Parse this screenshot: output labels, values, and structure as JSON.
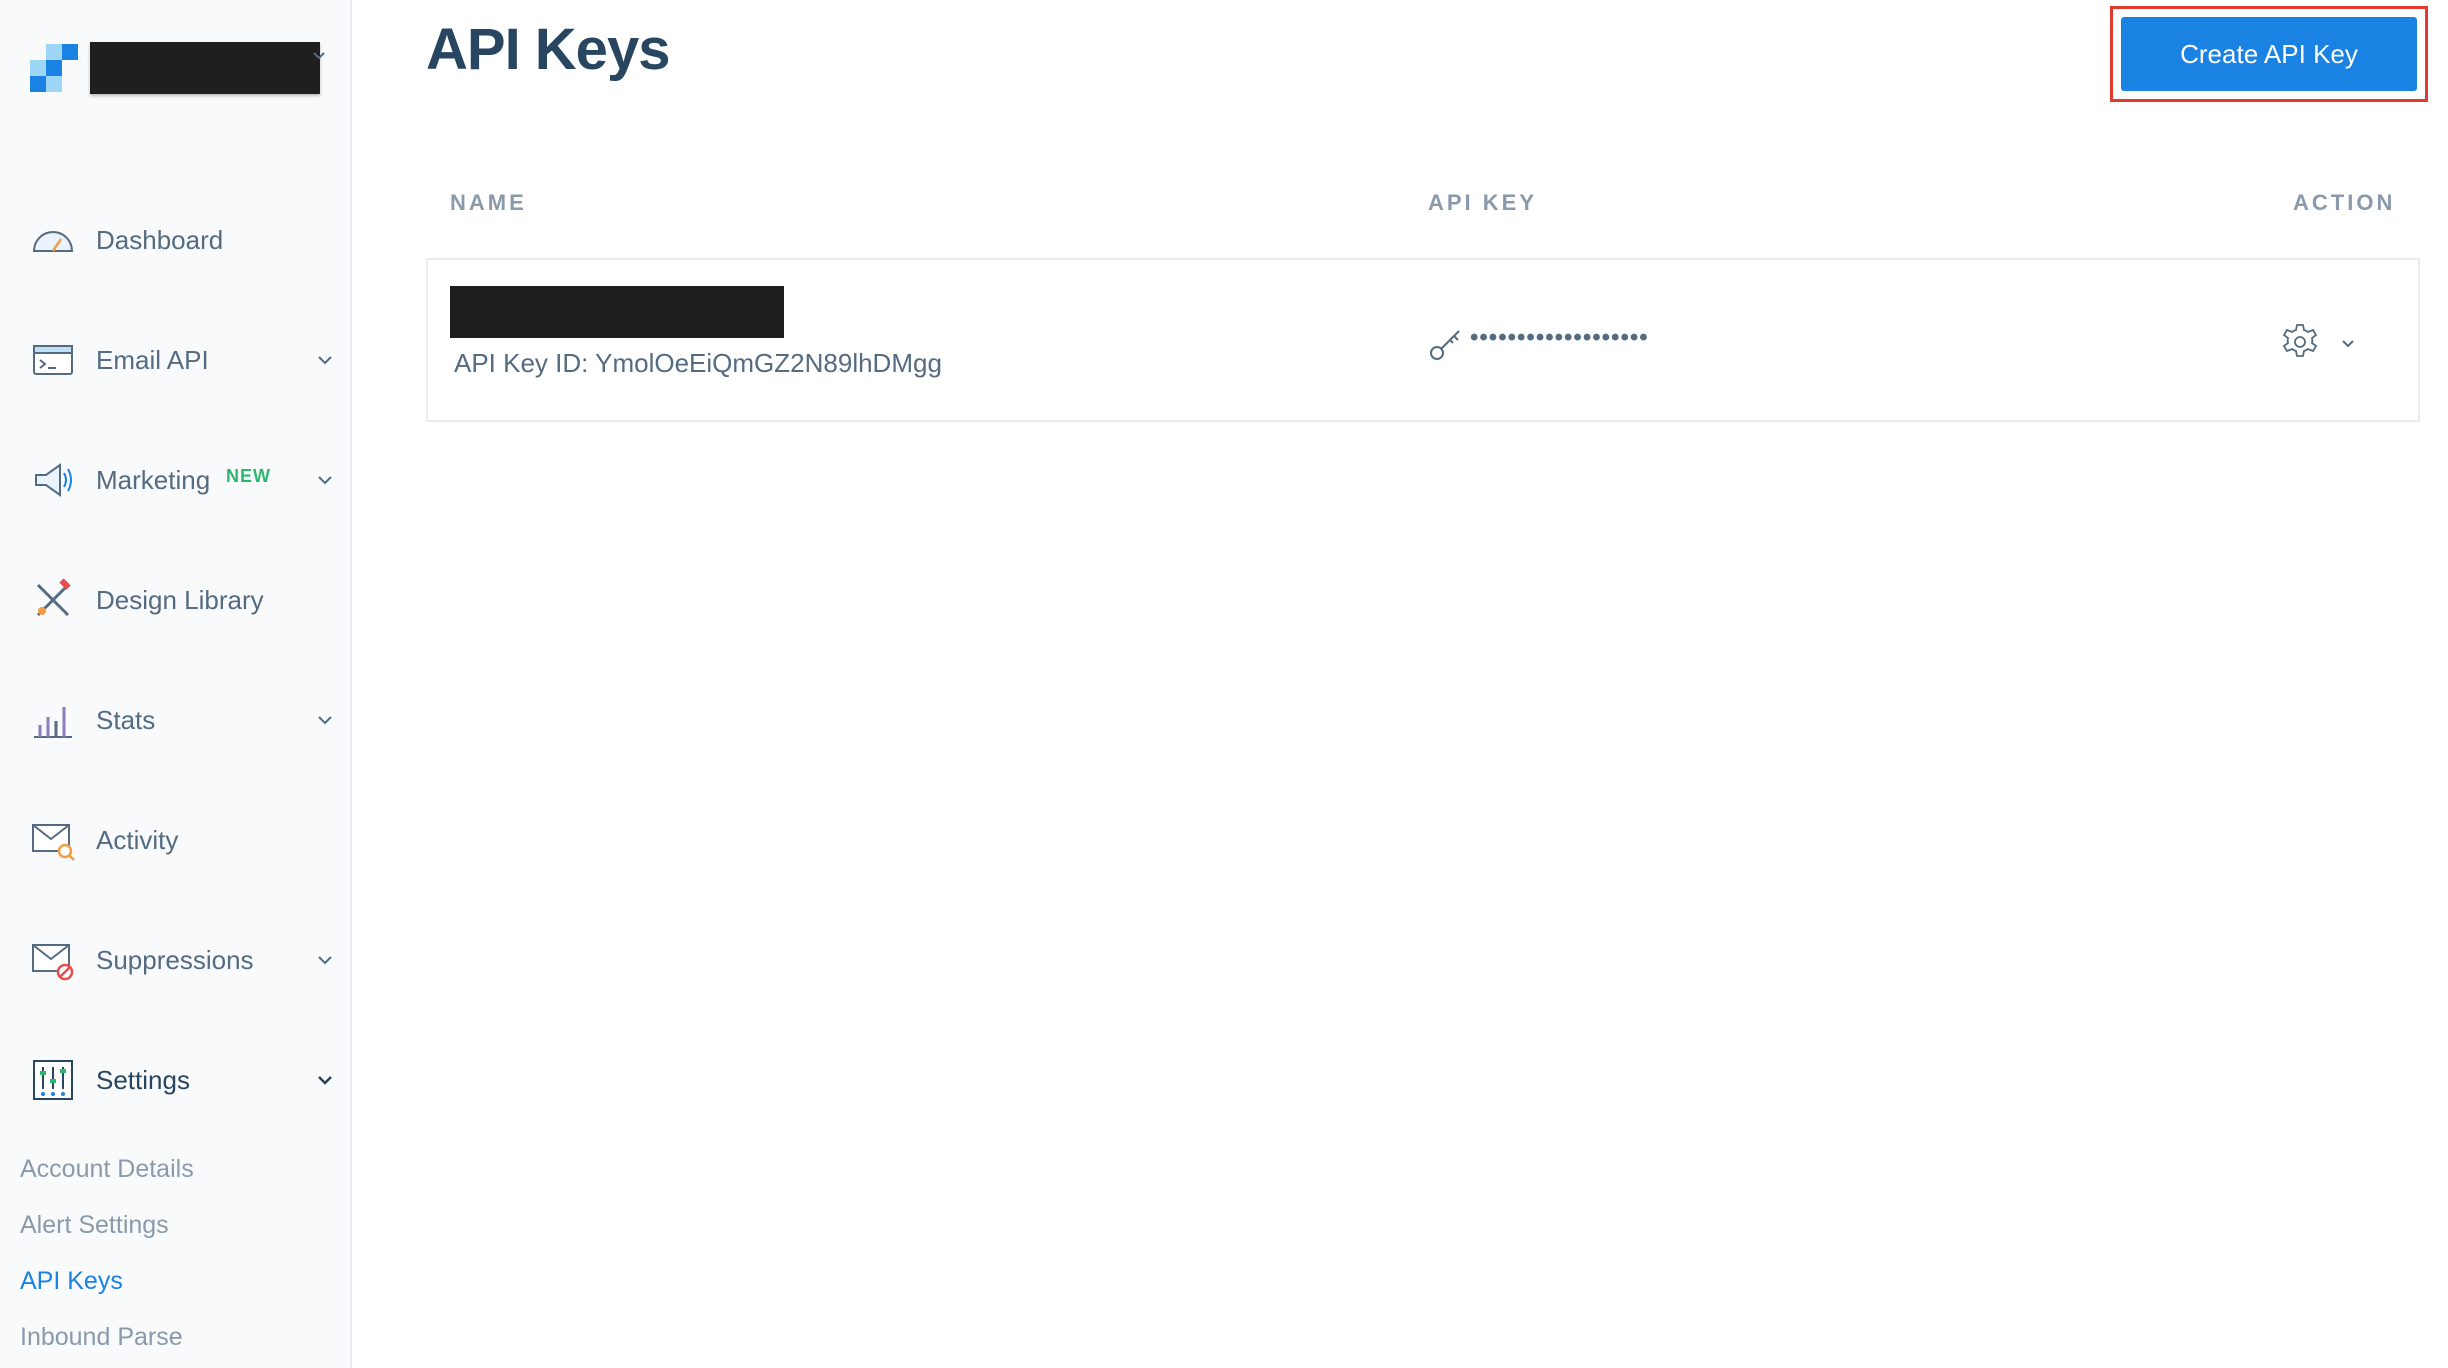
{
  "sidebar": {
    "items": [
      {
        "label": "Dashboard",
        "icon": "gauge-icon"
      },
      {
        "label": "Email API",
        "icon": "terminal-window-icon"
      },
      {
        "label": "Marketing",
        "badge": "NEW",
        "icon": "megaphone-icon"
      },
      {
        "label": "Design Library",
        "icon": "design-tools-icon"
      },
      {
        "label": "Stats",
        "icon": "bar-chart-icon"
      },
      {
        "label": "Activity",
        "icon": "envelope-search-icon"
      },
      {
        "label": "Suppressions",
        "icon": "envelope-block-icon"
      },
      {
        "label": "Settings",
        "icon": "sliders-icon"
      }
    ],
    "sub_items": [
      "Account Details",
      "Alert Settings",
      "API Keys",
      "Inbound Parse"
    ],
    "active_sub": "API Keys"
  },
  "header": {
    "title": "API Keys",
    "create_button": "Create API Key"
  },
  "table": {
    "columns": [
      "NAME",
      "API KEY",
      "ACTION"
    ],
    "rows": [
      {
        "key_id": "API Key ID: YmolOeEiQmGZ2N89lhDMgg",
        "masked_key": "•••••••••••••••••••"
      }
    ]
  },
  "colors": {
    "accent": "#1a82e2",
    "title": "#294661",
    "text": "#546b81",
    "badge": "#2fb572",
    "highlight": "#e23b2e"
  }
}
